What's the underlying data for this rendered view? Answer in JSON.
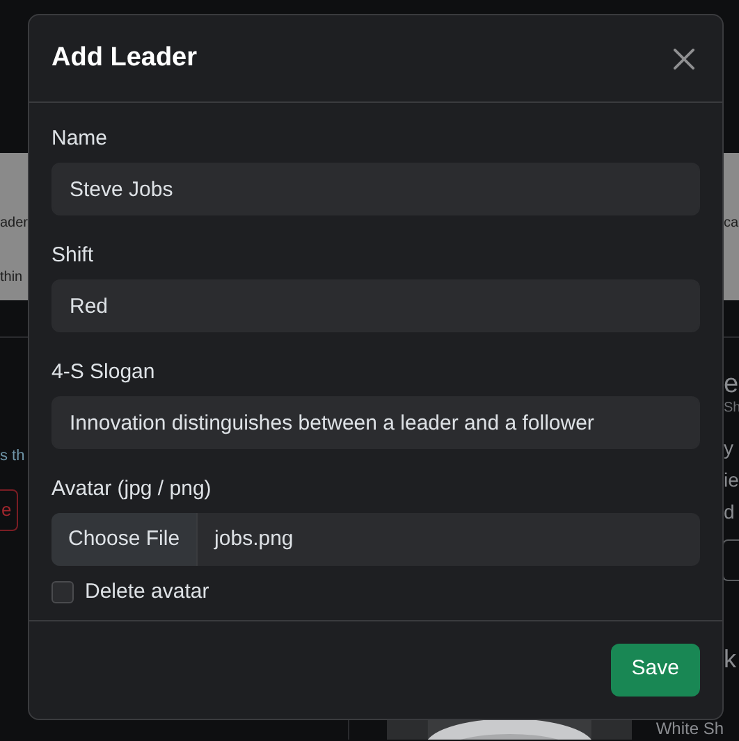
{
  "background": {
    "banner": {
      "left_lines": [
        "ader",
        "thin"
      ],
      "right_text": "ca"
    },
    "left_column": {
      "text": "s th",
      "button": "e"
    },
    "right_column": {
      "heading": "e",
      "subtitle": "Sh",
      "lines": [
        "y",
        "ie",
        "d"
      ],
      "name": "k",
      "caption": "White Sh"
    }
  },
  "modal": {
    "title": "Add Leader",
    "fields": [
      {
        "kind": "text",
        "label": "Name",
        "value": "Steve Jobs"
      },
      {
        "kind": "text",
        "label": "Shift",
        "value": "Red"
      },
      {
        "kind": "text",
        "label": "4-S Slogan",
        "value": "Innovation distinguishes between a leader and a follower"
      },
      {
        "kind": "file",
        "label": "Avatar (jpg / png)",
        "button": "Choose File",
        "value": "jobs.png"
      }
    ],
    "checkbox": {
      "label": "Delete avatar",
      "checked": false
    },
    "save": "Save"
  }
}
